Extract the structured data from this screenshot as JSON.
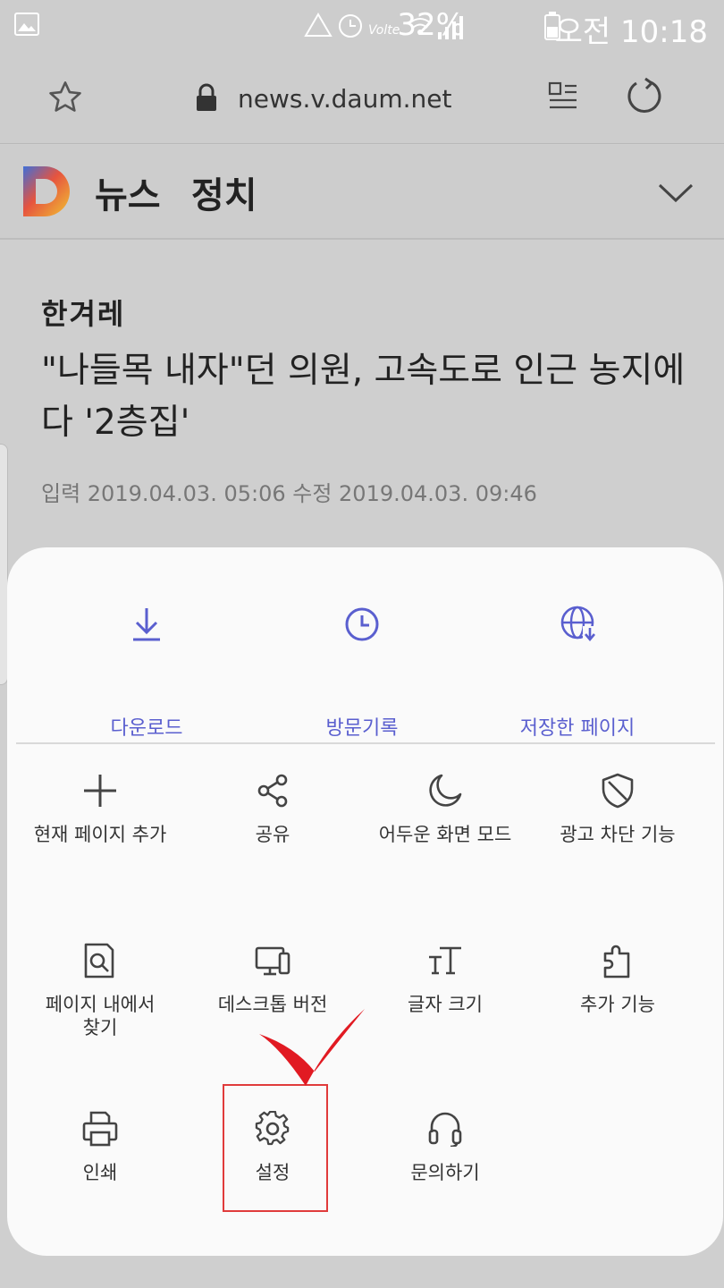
{
  "status_bar": {
    "battery_percent": "32%",
    "time": "오전 10:18"
  },
  "browser": {
    "url": "news.v.daum.net"
  },
  "site_header": {
    "title": "뉴스",
    "section": "정치"
  },
  "article": {
    "press": "한겨레",
    "headline": "\"나들목 내자\"던 의원, 고속도로 인근 농지에다 '2층집'",
    "dates": "입력 2019.04.03. 05:06   수정 2019.04.03. 09:46"
  },
  "menu": {
    "top_items": [
      {
        "label": "다운로드",
        "icon": "download-icon"
      },
      {
        "label": "방문기록",
        "icon": "history-clock-icon"
      },
      {
        "label": "저장한 페이지",
        "icon": "saved-page-globe-icon"
      }
    ],
    "grid_items": [
      {
        "label": "현재 페이지 추가",
        "icon": "plus-icon"
      },
      {
        "label": "공유",
        "icon": "share-icon"
      },
      {
        "label": "어두운 화면 모드",
        "icon": "moon-icon"
      },
      {
        "label": "광고 차단 기능",
        "icon": "shield-icon"
      },
      {
        "label": "페이지 내에서\n찾기",
        "icon": "find-in-page-icon"
      },
      {
        "label": "데스크톱 버전",
        "icon": "desktop-icon"
      },
      {
        "label": "글자 크기",
        "icon": "text-size-icon"
      },
      {
        "label": "추가 기능",
        "icon": "puzzle-icon"
      },
      {
        "label": "인쇄",
        "icon": "printer-icon"
      },
      {
        "label": "설정",
        "icon": "gear-icon"
      },
      {
        "label": "문의하기",
        "icon": "headset-icon"
      }
    ]
  },
  "colors": {
    "accent": "#5a5fcf",
    "highlight": "#e03b3b",
    "overlay": "#cfcfcf"
  }
}
